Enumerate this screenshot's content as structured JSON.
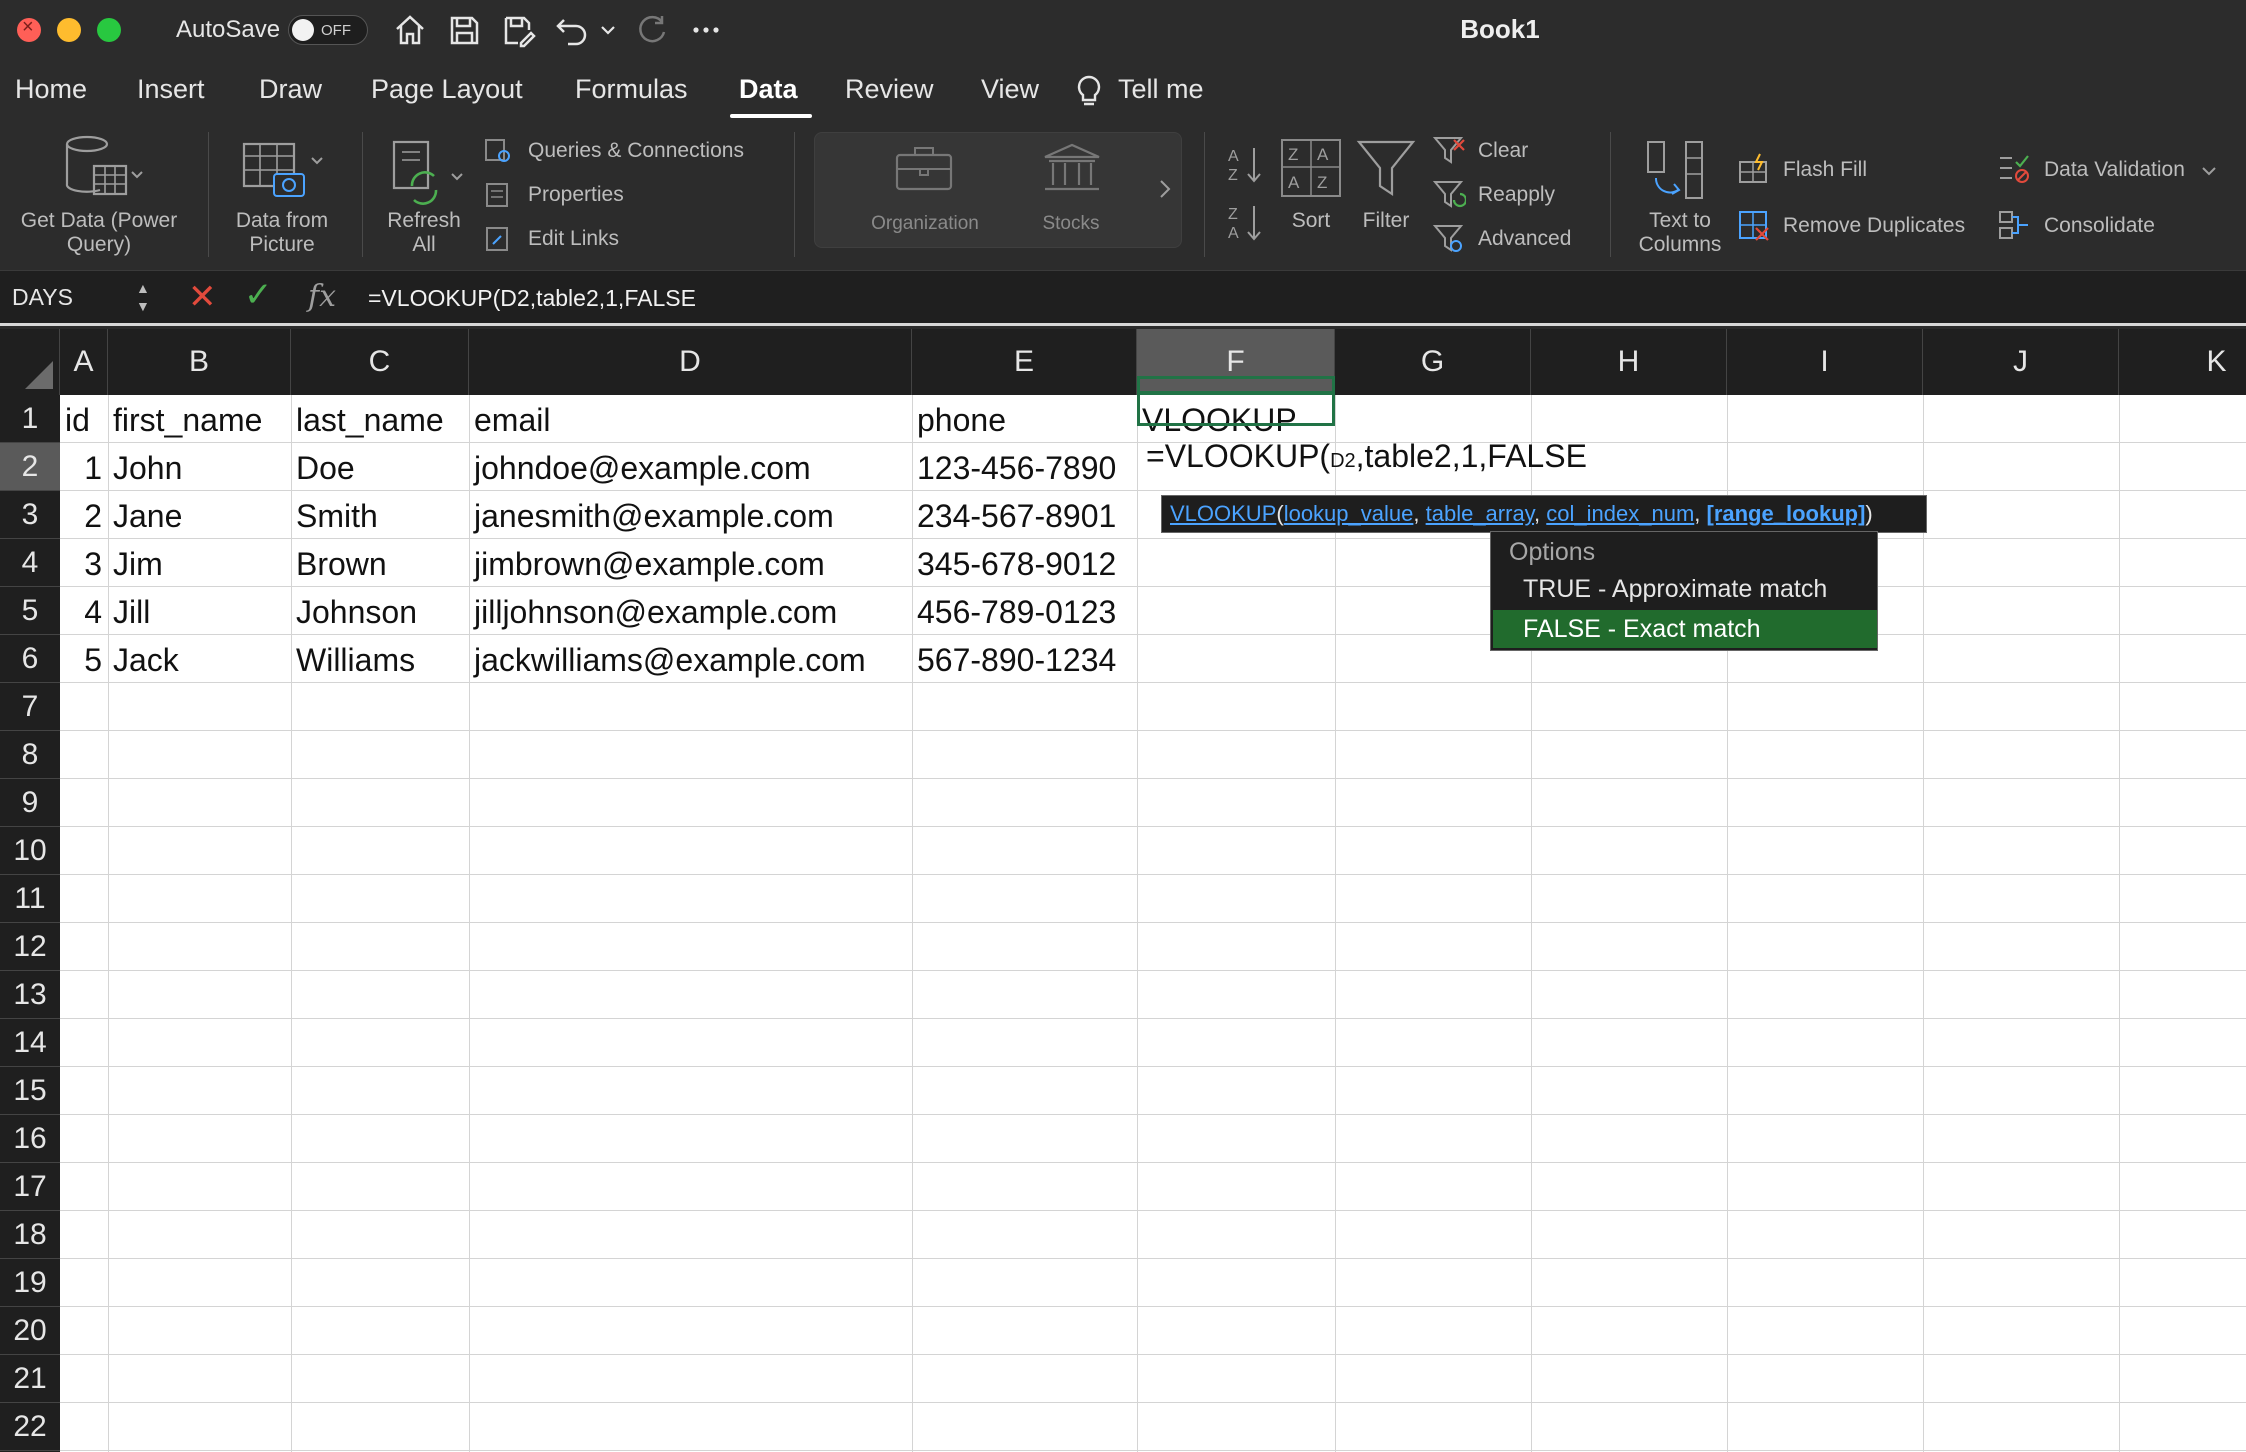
{
  "titlebar": {
    "autosave_label": "AutoSave",
    "autosave_state": "OFF",
    "title": "Book1"
  },
  "menu": {
    "tabs": [
      "Home",
      "Insert",
      "Draw",
      "Page Layout",
      "Formulas",
      "Data",
      "Review",
      "View"
    ],
    "active_tab": "Data",
    "tell_me": "Tell me"
  },
  "ribbon": {
    "get_data": "Get Data (Power Query)",
    "get_data_l1": "Get Data (Power",
    "get_data_l2": "Query)",
    "data_from_picture_l1": "Data from",
    "data_from_picture_l2": "Picture",
    "refresh_l1": "Refresh",
    "refresh_l2": "All",
    "queries": "Queries & Connections",
    "properties": "Properties",
    "edit_links": "Edit Links",
    "organization": "Organization",
    "stocks": "Stocks",
    "sort": "Sort",
    "filter": "Filter",
    "clear": "Clear",
    "reapply": "Reapply",
    "advanced": "Advanced",
    "text_to_columns_l1": "Text to",
    "text_to_columns_l2": "Columns",
    "flash_fill": "Flash Fill",
    "remove_duplicates": "Remove Duplicates",
    "data_validation": "Data Validation",
    "consolidate": "Consolidate"
  },
  "formula_bar": {
    "name_box": "DAYS",
    "fx": "fx",
    "formula": "=VLOOKUP(D2,table2,1,FALSE"
  },
  "sheet": {
    "columns": [
      "A",
      "B",
      "C",
      "D",
      "E",
      "F",
      "G",
      "H",
      "I",
      "J",
      "K"
    ],
    "selected_column": "F",
    "rows": [
      "1",
      "2",
      "3",
      "4",
      "5",
      "6",
      "7",
      "8",
      "9",
      "10",
      "11",
      "12",
      "13",
      "14",
      "15",
      "16",
      "17",
      "18",
      "19",
      "20",
      "21",
      "22"
    ],
    "selected_row": "2",
    "header_row": [
      "id",
      "first_name",
      "last_name",
      "email",
      "phone",
      "VLOOKUP"
    ],
    "data": [
      [
        "1",
        "John",
        "Doe",
        "johndoe@example.com",
        "123-456-7890"
      ],
      [
        "2",
        "Jane",
        "Smith",
        "janesmith@example.com",
        "234-567-8901"
      ],
      [
        "3",
        "Jim",
        "Brown",
        "jimbrown@example.com",
        "345-678-9012"
      ],
      [
        "4",
        "Jill",
        "Johnson",
        "jilljohnson@example.com",
        "456-789-0123"
      ],
      [
        "5",
        "Jack",
        "Williams",
        "jackwilliams@example.com",
        "567-890-1234"
      ]
    ],
    "edit_prefix": "=VLOOKUP(",
    "edit_ref": "D2",
    "edit_suffix": ",table2,1,FALSE"
  },
  "tooltip": {
    "fn": "VLOOKUP",
    "open": "(",
    "arg1": "lookup_value",
    "arg2": "table_array",
    "arg3": "col_index_num",
    "arg4": "[range_lookup]",
    "comma": ", ",
    "close": ")"
  },
  "options": {
    "title": "Options",
    "items": [
      "TRUE - Approximate match",
      "FALSE - Exact match"
    ],
    "selected": "FALSE - Exact match"
  },
  "colors": {
    "accent_green": "#217346",
    "selected_option": "#216b2d",
    "link_blue": "#4ba3ff"
  }
}
